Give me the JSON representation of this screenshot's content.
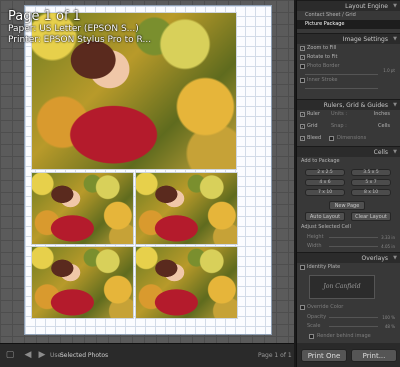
{
  "page_info": {
    "title": "Page 1 of 1",
    "paper": "Paper: US Letter (EPSON S...)",
    "printer": "Printer: EPSON Stylus Pro to R..."
  },
  "status": {
    "use_label": "Use:",
    "use_value": "Selected Photos",
    "page_counter": "Page 1 of 1"
  },
  "panel": {
    "layout_engine": {
      "header": "Layout Engine",
      "items": [
        "Contact Sheet / Grid",
        "Picture Package"
      ],
      "selected": "Picture Package"
    },
    "image_settings": {
      "header": "Image Settings",
      "zoom": "Zoom to Fill",
      "rotate": "Rotate to Fit",
      "photo_border": "Photo Border",
      "inner_stroke": "Inner Stroke",
      "border_value": "1.0 pt"
    },
    "rulers": {
      "header": "Rulers, Grid & Guides",
      "ruler_label": "Ruler",
      "units_label": "Units :",
      "units_value": "Inches",
      "grid_label": "Grid",
      "snap_label": "Snap :",
      "snap_value": "Cells",
      "bleed_label": "Bleed",
      "dimensions_label": "Dimensions"
    },
    "cells": {
      "header": "Cells",
      "add_to_package": "Add to Package",
      "sizes": [
        "2 x 2.5",
        "3.5 x 5",
        "4 x 6",
        "5 x 7",
        "7 x 10",
        "8 x 10"
      ],
      "new_page": "New Page",
      "auto_layout": "Auto Layout",
      "clear_layout": "Clear Layout",
      "adjust_label": "Adjust Selected Cell",
      "height_label": "Height",
      "width_label": "Width",
      "height_value": "3.33 in",
      "width_value": "4.05 in"
    },
    "overlays": {
      "header": "Overlays",
      "identity_plate": "Identity Plate",
      "signature": "Jon Canfield",
      "override_color": "Override Color",
      "opacity_label": "Opacity",
      "opacity_value": "100 %",
      "scale_label": "Scale",
      "scale_value": "48 %",
      "render_behind": "Render behind image"
    }
  },
  "buttons": {
    "print_one": "Print One",
    "print": "Print..."
  }
}
